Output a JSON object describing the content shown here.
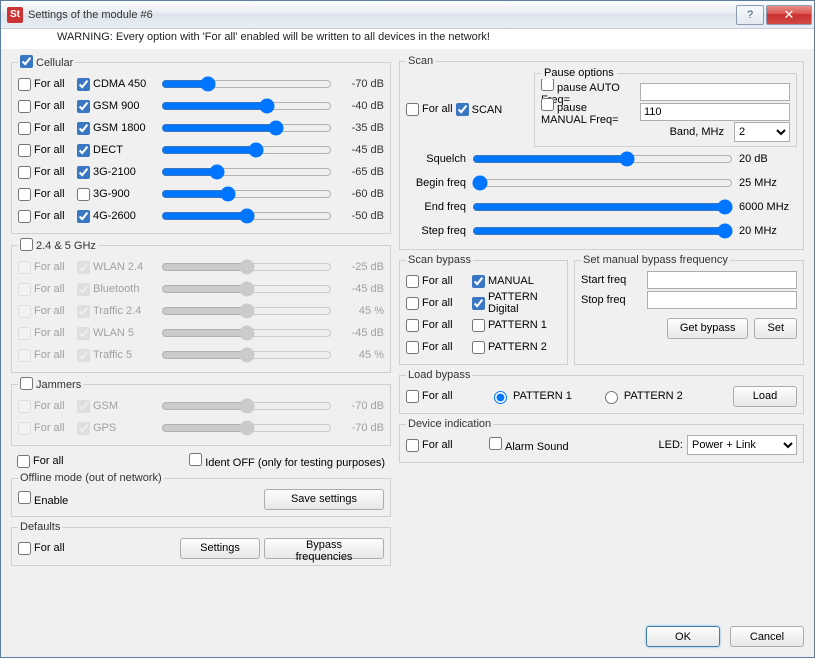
{
  "window": {
    "title": "Settings of the module #6",
    "icon_text": "St"
  },
  "warning": "WARNING: Every option with 'For all' enabled will be written to all devices in the network!",
  "labels": {
    "for_all": "For all"
  },
  "cellular": {
    "legend": "Cellular",
    "rows": [
      {
        "name": "CDMA 450",
        "val": "-70 dB",
        "db": -70
      },
      {
        "name": "GSM 900",
        "val": "-40 dB",
        "db": -40
      },
      {
        "name": "GSM 1800",
        "val": "-35 dB",
        "db": -35
      },
      {
        "name": "DECT",
        "val": "-45 dB",
        "db": -45
      },
      {
        "name": "3G-2100",
        "val": "-65 dB",
        "db": -65
      },
      {
        "name": "3G-900",
        "val": "-60 dB",
        "db": -60,
        "enabled": false
      },
      {
        "name": "4G-2600",
        "val": "-50 dB",
        "db": -50
      }
    ]
  },
  "ghz": {
    "legend": "2.4 & 5 GHz",
    "rows": [
      {
        "name": "WLAN 2.4",
        "val": "-25 dB"
      },
      {
        "name": "Bluetooth",
        "val": "-45 dB"
      },
      {
        "name": "Traffic 2.4",
        "val": "45 %"
      },
      {
        "name": "WLAN 5",
        "val": "-45 dB"
      },
      {
        "name": "Traffic 5",
        "val": "45 %"
      }
    ]
  },
  "jammers": {
    "legend": "Jammers",
    "rows": [
      {
        "name": "GSM",
        "val": "-70 dB"
      },
      {
        "name": "GPS",
        "val": "-70 dB"
      }
    ]
  },
  "ident": {
    "for_all": "For all",
    "label": "Ident OFF (only for testing purposes)"
  },
  "offline": {
    "legend": "Offline mode (out of network)",
    "enable": "Enable",
    "save": "Save settings"
  },
  "defaults": {
    "legend": "Defaults",
    "for_all": "For all",
    "settings": "Settings",
    "bypass": "Bypass frequencies"
  },
  "scan": {
    "legend": "Scan",
    "for_all": "For all",
    "scan": "SCAN",
    "pause_legend": "Pause options",
    "pause_auto": "pause AUTO   Freq=",
    "pause_auto_val": "",
    "pause_manual": "pause MANUAL Freq=",
    "pause_manual_val": "110",
    "band": "Band, MHz",
    "band_val": "2",
    "squelch": {
      "lbl": "Squelch",
      "val": "20 dB"
    },
    "begin": {
      "lbl": "Begin freq",
      "val": "25 MHz"
    },
    "end": {
      "lbl": "End freq",
      "val": "6000 MHz"
    },
    "step": {
      "lbl": "Step freq",
      "val": "20 MHz"
    }
  },
  "scan_bypass": {
    "legend": "Scan bypass",
    "rows": [
      {
        "name": "MANUAL",
        "checked": true
      },
      {
        "name": "PATTERN Digital",
        "checked": true
      },
      {
        "name": "PATTERN 1",
        "checked": false
      },
      {
        "name": "PATTERN 2",
        "checked": false
      }
    ]
  },
  "manual_bypass": {
    "legend": "Set manual bypass frequency",
    "start": "Start freq",
    "stop": "Stop freq",
    "get": "Get bypass",
    "set": "Set"
  },
  "load_bypass": {
    "legend": "Load bypass",
    "p1": "PATTERN 1",
    "p2": "PATTERN 2",
    "load": "Load"
  },
  "device": {
    "legend": "Device indication",
    "alarm": "Alarm Sound",
    "led": "LED:",
    "led_val": "Power + Link"
  },
  "buttons": {
    "ok": "OK",
    "cancel": "Cancel"
  }
}
